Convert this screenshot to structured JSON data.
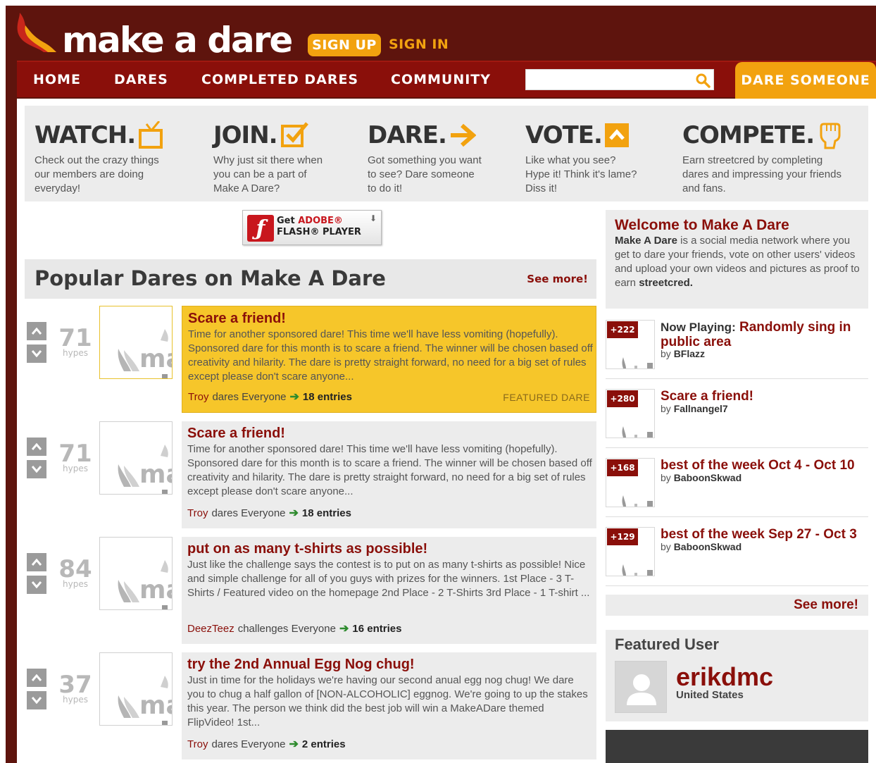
{
  "brand": {
    "logo_text": "make a dare",
    "signup_label": "SIGN UP",
    "signin_label": "SIGN IN",
    "colors": {
      "dark_red": "#5e140d",
      "nav_red": "#8a0f0a",
      "orange": "#f2a20f",
      "featured_yellow": "#f6c62a"
    }
  },
  "nav": {
    "items": [
      "HOME",
      "DARES",
      "COMPLETED DARES",
      "COMMUNITY"
    ],
    "search_placeholder": "",
    "dare_someone_label": "DARE SOMEONE"
  },
  "features": [
    {
      "title": "WATCH.",
      "icon": "tv-icon",
      "desc": [
        "Check out the crazy things",
        "our members are doing",
        "everyday!"
      ]
    },
    {
      "title": "JOIN.",
      "icon": "checkbox-icon",
      "desc": [
        "Why just sit there when",
        "you can be a part of",
        "Make A Dare?"
      ]
    },
    {
      "title": "DARE.",
      "icon": "arrow-right-icon",
      "desc": [
        "Got something you want",
        "to see? Dare someone",
        "to do it!"
      ]
    },
    {
      "title": "VOTE.",
      "icon": "vote-up-icon",
      "desc": [
        "Like what you see?",
        "Hype it! Think it's lame?",
        "Diss it!"
      ]
    },
    {
      "title": "COMPETE.",
      "icon": "fist-icon",
      "desc": [
        "Earn streetcred by completing",
        "dares and impressing your friends",
        "and fans."
      ]
    }
  ],
  "flash": {
    "line1_prefix": "Get",
    "line1_brand": "ADOBE®",
    "line2": "FLASH® PLAYER"
  },
  "popular": {
    "title": "Popular Dares on Make A Dare",
    "see_more": "See more!",
    "hypes_label": "hypes",
    "featured_tag": "FEATURED DARE",
    "dares": [
      {
        "hypes": "71",
        "title": "Scare a friend!",
        "desc": "Time for another sponsored dare! This time we'll have less vomiting (hopefully). Sponsored dare for this month is to scare a friend. The winner will be chosen based off creativity and hilarity. The dare is pretty straight forward, no need for a big set of rules except please don't scare anyone...",
        "user": "Troy",
        "verb": "dares Everyone",
        "entries": "18 entries",
        "featured": true
      },
      {
        "hypes": "71",
        "title": "Scare a friend!",
        "desc": "Time for another sponsored dare! This time we'll have less vomiting (hopefully). Sponsored dare for this month is to scare a friend. The winner will be chosen based off creativity and hilarity. The dare is pretty straight forward, no need for a big set of rules except please don't scare anyone...",
        "user": "Troy",
        "verb": "dares Everyone",
        "entries": "18 entries",
        "featured": false
      },
      {
        "hypes": "84",
        "title": "put on as many t-shirts as possible!",
        "desc": "Just like the challenge says the contest is to put on as many t-shirts as possible! Nice and simple challenge for all of you guys with prizes for the winners. 1st Place - 3 T-Shirts / Featured video on the homepage 2nd Place - 2 T-Shirts 3rd Place - 1 T-shirt ...",
        "user": "DeezTeez",
        "verb": "challenges Everyone",
        "entries": "16 entries",
        "featured": false
      },
      {
        "hypes": "37",
        "title": "try the 2nd Annual Egg Nog chug!",
        "desc": "Just in time for the holidays we're having our second anual egg nog chug! We dare you to chug a half gallon of [NON-ALCOHOLIC] eggnog. We're going to up the stakes this year. The person we think did the best job will win a MakeADare themed FlipVideo! 1st...",
        "user": "Troy",
        "verb": "dares Everyone",
        "entries": "2 entries",
        "featured": false
      }
    ]
  },
  "welcome": {
    "title": "Welcome to Make A Dare",
    "brand_bold": "Make A Dare",
    "text": " is a social media network where you get to dare your friends, vote on other users' videos and upload your own videos and pictures as proof to earn ",
    "streetcred": "streetcred."
  },
  "now_playing": {
    "prefix": "Now Playing:",
    "by_label": "by",
    "items": [
      {
        "badge": "+222",
        "title": "Randomly sing in public area",
        "user": "BFlazz"
      },
      {
        "badge": "+280",
        "title": "Scare a friend!",
        "user": "Fallnangel7"
      },
      {
        "badge": "+168",
        "title": "best of the week Oct 4 - Oct 10",
        "user": "BaboonSkwad"
      },
      {
        "badge": "+129",
        "title": "best of the week Sep 27 - Oct 3",
        "user": "BaboonSkwad"
      }
    ],
    "see_more": "See more!"
  },
  "featured_user": {
    "title": "Featured User",
    "name": "erikdmc",
    "location": "United States"
  }
}
